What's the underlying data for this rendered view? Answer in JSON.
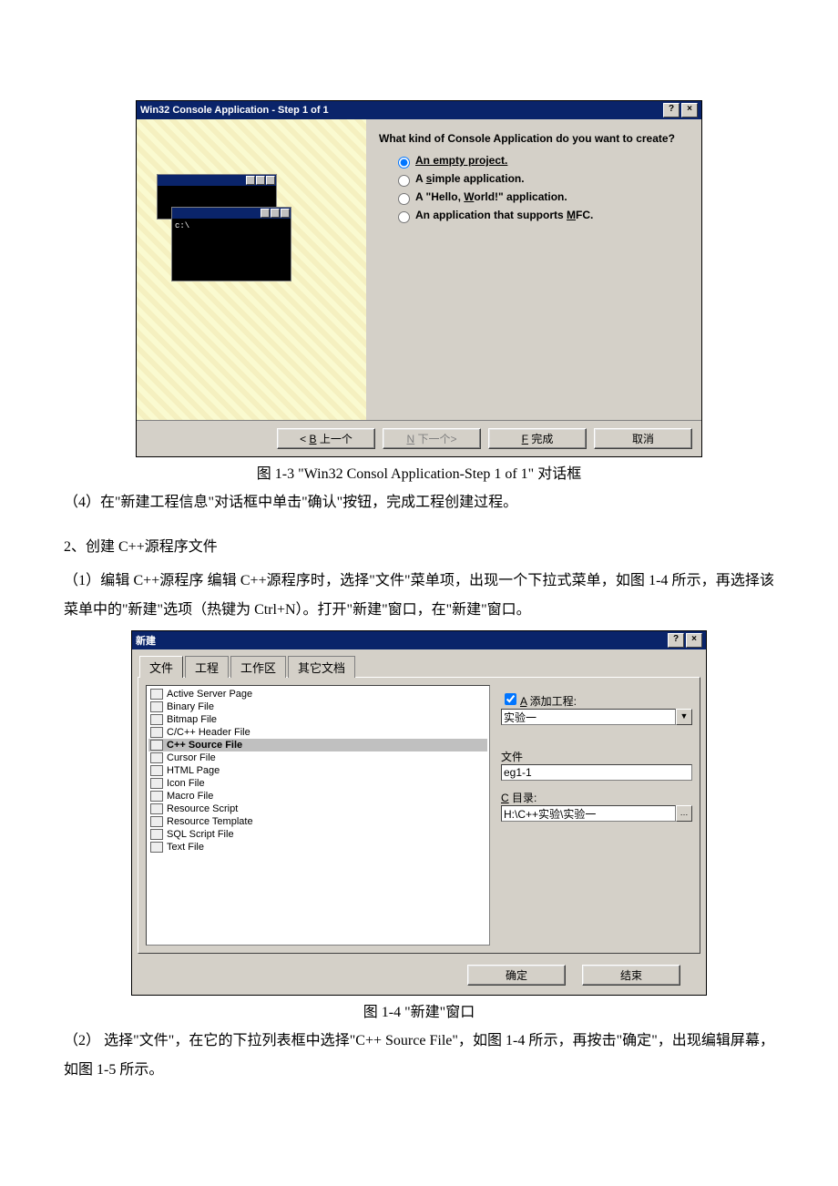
{
  "dialog1": {
    "title": "Win32 Console Application - Step 1 of 1",
    "mini_prompt": "c:\\",
    "question": "What kind of Console Application do you want to create?",
    "options": {
      "empty": "An empty project.",
      "simple_pre": "A ",
      "simple_u": "s",
      "simple_post": "imple application.",
      "hello_pre": "A \"Hello, ",
      "hello_u": "W",
      "hello_post": "orld!\" application.",
      "mfc_pre": "An application that supports ",
      "mfc_u": "M",
      "mfc_post": "FC."
    },
    "buttons": {
      "back_pre": "< ",
      "back_u": "B",
      "back_post": " 上一个",
      "next_u": "N",
      "next_post": " 下一个>",
      "finish_u": "F",
      "finish_post": " 完成",
      "cancel": "取消"
    }
  },
  "caption1": "图 1-3  \"Win32 Consol Application-Step 1 of 1\"  对话框",
  "para4": "（4）在\"新建工程信息\"对话框中单击\"确认\"按钮，完成工程创建过程。",
  "section2": "2、创建 C++源程序文件",
  "para_edit": "（1）编辑 C++源程序   编辑 C++源程序时，选择\"文件\"菜单项，出现一个下拉式菜单，如图 1-4 所示，再选择该菜单中的\"新建\"选项（热键为 Ctrl+N）。打开\"新建\"窗口，在\"新建\"窗口。",
  "dialog2": {
    "title": "新建",
    "tabs": {
      "files": "文件",
      "project": "工程",
      "workspace": "工作区",
      "other": "其它文档"
    },
    "fileTypes": [
      "Active Server Page",
      "Binary File",
      "Bitmap File",
      "C/C++ Header File",
      "C++ Source File",
      "Cursor File",
      "HTML Page",
      "Icon File",
      "Macro File",
      "Resource Script",
      "Resource Template",
      "SQL Script File",
      "Text File"
    ],
    "selectedIndex": 4,
    "add_label_u": "A",
    "add_label_post": " 添加工程:",
    "project_value": "实验一",
    "file_label": "文件",
    "file_value": "eg1-1",
    "dir_label_u": "C",
    "dir_label_post": " 目录:",
    "dir_value": "H:\\C++实验\\实验一",
    "ok": "确定",
    "close": "结束"
  },
  "caption2": "图 1-4  \"新建\"窗口",
  "para_sel": "（2） 选择\"文件\"，在它的下拉列表框中选择\"C++ Source File\"，如图 1-4 所示，再按击\"确定\"，出现编辑屏幕，如图 1-5 所示。"
}
